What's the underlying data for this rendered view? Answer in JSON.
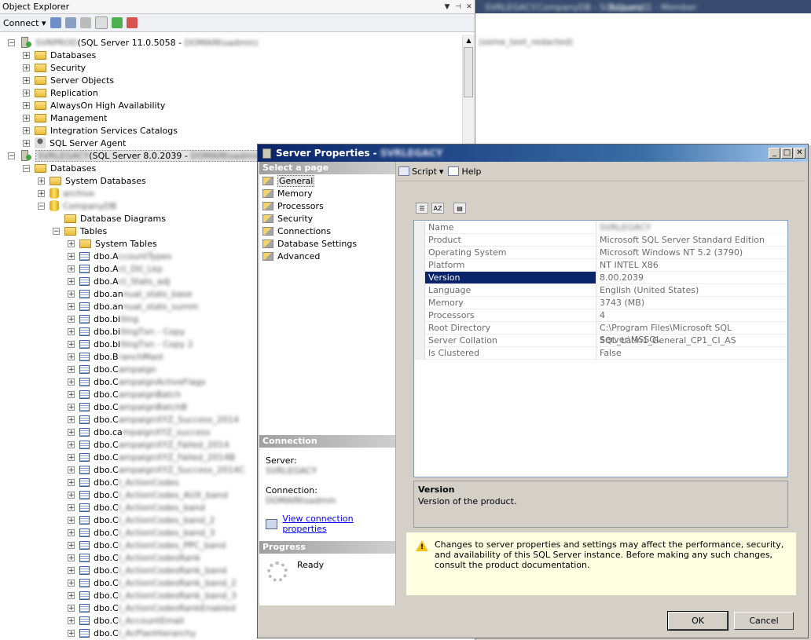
{
  "object_explorer": {
    "title": "Object Explorer",
    "connect_label": "Connect",
    "server1": {
      "name": "SVRPROD",
      "version": "(SQL Server 11.0.5058 - ",
      "login": "DOMAIN\\sadmin)"
    },
    "server1_children": [
      "Databases",
      "Security",
      "Server Objects",
      "Replication",
      "AlwaysOn High Availability",
      "Management",
      "Integration Services Catalogs",
      "SQL Server Agent"
    ],
    "server2": {
      "name": "SVRLEGACY",
      "version": "(SQL Server 8.0.2039 - ",
      "login": "DOMAIN\\sadmin)"
    },
    "databases_label": "Databases",
    "system_databases_label": "System Databases",
    "db1_name": "archive",
    "db2_name": "CompanyDB",
    "diagrams_label": "Database Diagrams",
    "tables_label": "Tables",
    "system_tables_label": "System Tables",
    "tables": [
      {
        "prefix": "dbo.A",
        "rest": "ccountTypes"
      },
      {
        "prefix": "dbo.A",
        "rest": "ct_Dtl_Lkp"
      },
      {
        "prefix": "dbo.A",
        "rest": "ct_Stats_adj"
      },
      {
        "prefix": "dbo.an",
        "rest": "nual_stats_base"
      },
      {
        "prefix": "dbo.an",
        "rest": "nual_stats_summ"
      },
      {
        "prefix": "dbo.bi",
        "rest": "lling"
      },
      {
        "prefix": "dbo.bi",
        "rest": "llingTxn - Copy"
      },
      {
        "prefix": "dbo.bi",
        "rest": "llingTxn - Copy 2"
      },
      {
        "prefix": "dbo.B",
        "rest": "ranchMast"
      },
      {
        "prefix": "dbo.C",
        "rest": "ampaign"
      },
      {
        "prefix": "dbo.C",
        "rest": "ampaignActiveFlags"
      },
      {
        "prefix": "dbo.C",
        "rest": "ampaignBatch"
      },
      {
        "prefix": "dbo.C",
        "rest": "ampaignBatchB"
      },
      {
        "prefix": "dbo.C",
        "rest": "ampaignXYZ_Success_2014"
      },
      {
        "prefix": "dbo.ca",
        "rest": "mpaignXYZ_success"
      },
      {
        "prefix": "dbo.C",
        "rest": "ampaignXYZ_Failed_2014"
      },
      {
        "prefix": "dbo.C",
        "rest": "ampaignXYZ_Failed_2014B"
      },
      {
        "prefix": "dbo.C",
        "rest": "ampaignXYZ_Success_2014C"
      },
      {
        "prefix": "dbo.C",
        "rest": "I_ActionCodes"
      },
      {
        "prefix": "dbo.C",
        "rest": "I_ActionCodes_AUX_band"
      },
      {
        "prefix": "dbo.C",
        "rest": "I_ActionCodes_band"
      },
      {
        "prefix": "dbo.C",
        "rest": "I_ActionCodes_band_2"
      },
      {
        "prefix": "dbo.C",
        "rest": "I_ActionCodes_band_3"
      },
      {
        "prefix": "dbo.C",
        "rest": "I_ActionCodes_PPC_band"
      },
      {
        "prefix": "dbo.C",
        "rest": "I_ActionCodesRank"
      },
      {
        "prefix": "dbo.C",
        "rest": "I_ActionCodesRank_band"
      },
      {
        "prefix": "dbo.C",
        "rest": "I_ActionCodesRank_band_2"
      },
      {
        "prefix": "dbo.C",
        "rest": "I_ActionCodesRank_band_3"
      },
      {
        "prefix": "dbo.C",
        "rest": "I_ActionCodesRankEnabled"
      },
      {
        "prefix": "dbo.C",
        "rest": "I_AccountEmail"
      },
      {
        "prefix": "dbo.C",
        "rest": "I_AcPlanHierarchy"
      }
    ]
  },
  "editor": {
    "tab1": "SVRLEGACY.CompanyDB - SQLQuery1",
    "tab2": "Request 1 - Member",
    "text": "(some_text_redacted)"
  },
  "dialog": {
    "title": "Server Properties - ",
    "title_server": "SVRLEGACY",
    "select_page": "Select a page",
    "pages": [
      "General",
      "Memory",
      "Processors",
      "Security",
      "Connections",
      "Database Settings",
      "Advanced"
    ],
    "script_label": "Script",
    "help_label": "Help",
    "properties": [
      {
        "name": "Name",
        "value": "SVRLEGACY"
      },
      {
        "name": "Product",
        "value": "Microsoft SQL Server Standard Edition"
      },
      {
        "name": "Operating System",
        "value": "Microsoft Windows NT 5.2 (3790)"
      },
      {
        "name": "Platform",
        "value": "NT INTEL X86"
      },
      {
        "name": "Version",
        "value": "8.00.2039"
      },
      {
        "name": "Language",
        "value": "English (United States)"
      },
      {
        "name": "Memory",
        "value": "3743 (MB)"
      },
      {
        "name": "Processors",
        "value": "4"
      },
      {
        "name": "Root Directory",
        "value": "C:\\Program Files\\Microsoft SQL Server\\MSSQL"
      },
      {
        "name": "Server Collation",
        "value": "SQL_Latin1_General_CP1_CI_AS"
      },
      {
        "name": "Is Clustered",
        "value": "False"
      }
    ],
    "desc_title": "Version",
    "desc_text": "Version of the product.",
    "connection_header": "Connection",
    "server_label": "Server:",
    "server_value": "SVRLEGACY",
    "connection_label": "Connection:",
    "connection_value": "DOMAIN\\sadmin",
    "view_conn_link": "View connection properties",
    "progress_header": "Progress",
    "progress_status": "Ready",
    "warning": "Changes to server properties and settings may affect the performance, security, and availability of this SQL Server instance. Before making any such changes, consult the product documentation.",
    "ok_label": "OK",
    "cancel_label": "Cancel"
  }
}
